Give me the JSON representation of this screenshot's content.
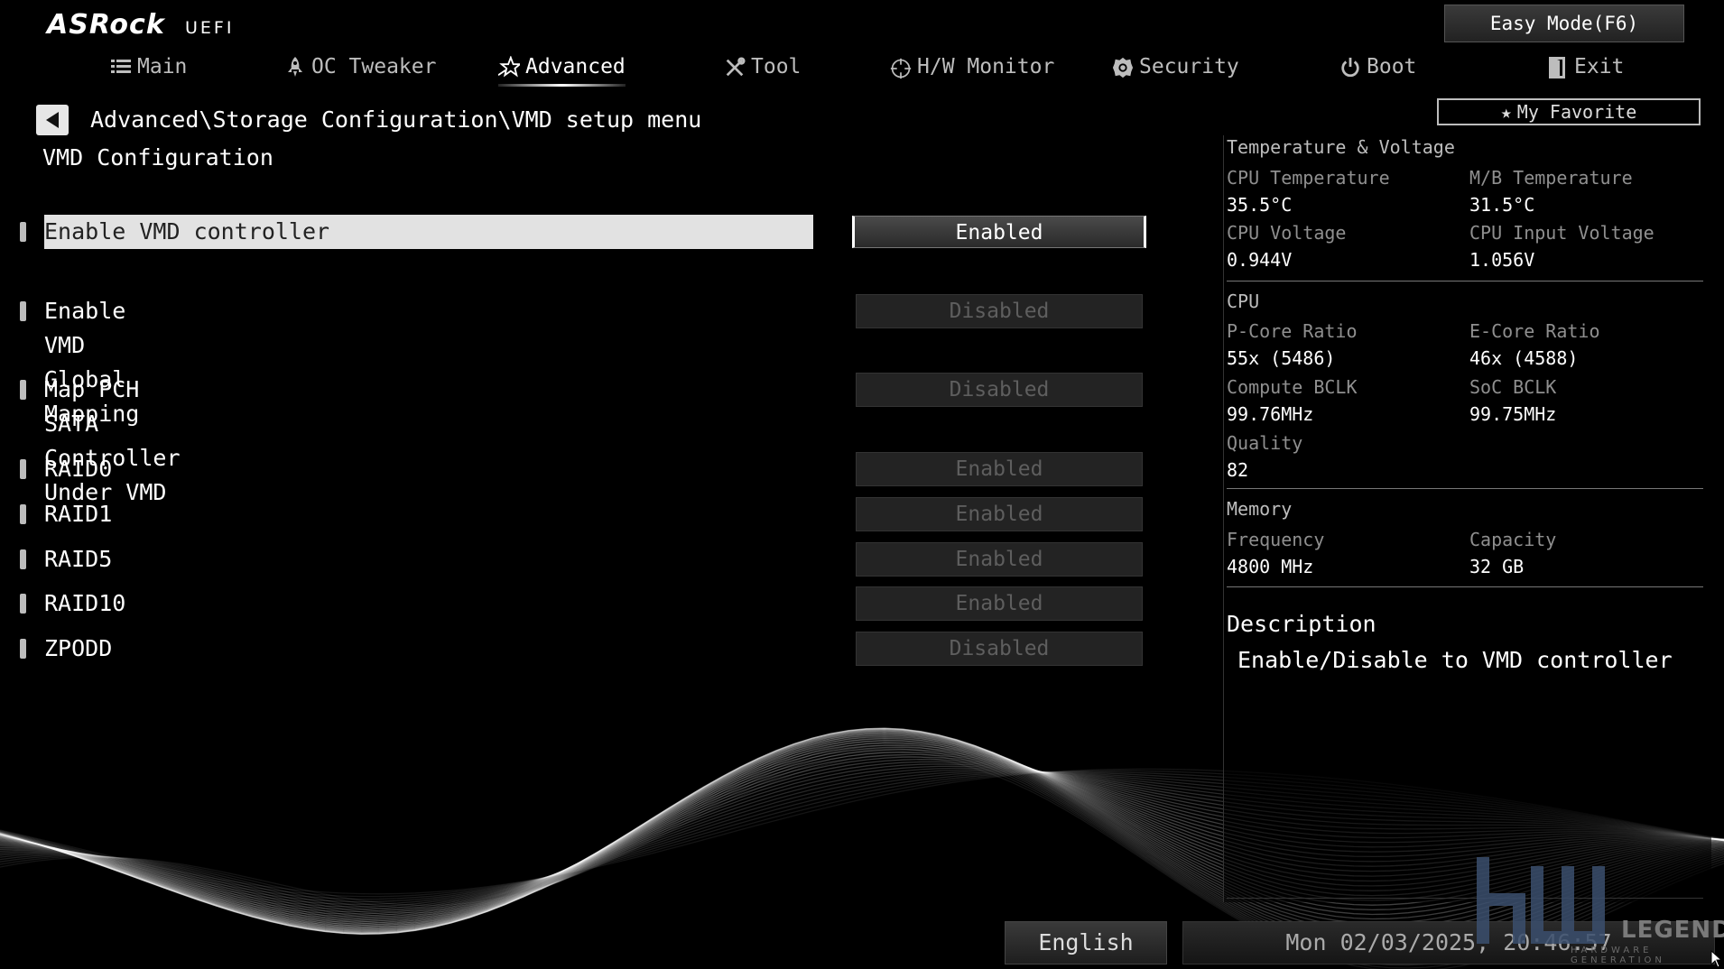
{
  "header": {
    "brand": "ASRock",
    "brand_sub": "UEFI",
    "easy_mode": "Easy Mode(F6)",
    "my_favorite": "My Favorite"
  },
  "tabs": [
    {
      "label": "Main",
      "icon": "list-icon"
    },
    {
      "label": "OC Tweaker",
      "icon": "rocket-icon"
    },
    {
      "label": "Advanced",
      "icon": "star-icon",
      "active": true
    },
    {
      "label": "Tool",
      "icon": "tools-icon"
    },
    {
      "label": "H/W Monitor",
      "icon": "crosshair-icon"
    },
    {
      "label": "Security",
      "icon": "shield-icon"
    },
    {
      "label": "Boot",
      "icon": "power-icon"
    },
    {
      "label": "Exit",
      "icon": "exit-icon"
    }
  ],
  "breadcrumb": "Advanced\\Storage Configuration\\VMD setup menu",
  "page_title": "VMD Configuration",
  "settings": [
    {
      "label": "Enable VMD controller",
      "value": "Enabled",
      "selected": true
    },
    {
      "label": "Enable VMD Global Mapping",
      "value": "Disabled"
    },
    {
      "label": "Map PCH SATA Controller Under VMD",
      "value": "Disabled"
    },
    {
      "label": "RAID0",
      "value": "Enabled"
    },
    {
      "label": "RAID1",
      "value": "Enabled"
    },
    {
      "label": "RAID5",
      "value": "Enabled"
    },
    {
      "label": "RAID10",
      "value": "Enabled"
    },
    {
      "label": "ZPODD",
      "value": "Disabled"
    }
  ],
  "panel": {
    "temp_voltage": {
      "title": "Temperature & Voltage",
      "cpu_temp_label": "CPU Temperature",
      "cpu_temp": "35.5°C",
      "mb_temp_label": "M/B Temperature",
      "mb_temp": "31.5°C",
      "cpu_volt_label": "CPU Voltage",
      "cpu_volt": "0.944V",
      "cpu_input_label": "CPU Input Voltage",
      "cpu_input": "1.056V"
    },
    "cpu": {
      "title": "CPU",
      "pcore_label": "P-Core Ratio",
      "pcore": "55x (5486)",
      "ecore_label": "E-Core Ratio",
      "ecore": "46x (4588)",
      "bclk_label": "Compute BCLK",
      "bclk": "99.76MHz",
      "soc_label": "SoC BCLK",
      "soc": "99.75MHz",
      "quality_label": "Quality",
      "quality": "82"
    },
    "memory": {
      "title": "Memory",
      "freq_label": "Frequency",
      "freq": "4800 MHz",
      "cap_label": "Capacity",
      "cap": "32 GB"
    },
    "description": {
      "title": "Description",
      "text": "Enable/Disable to VMD controller"
    }
  },
  "footer": {
    "language": "English",
    "datetime": "Mon 02/03/2025, 20:46:57"
  },
  "watermark": {
    "text": "LEGEND",
    "sub": "HARDWARE GENERATION"
  },
  "colors": {
    "background": "#000000",
    "text": "#ffffff",
    "selected_row": "#e2e2e2",
    "disabled_option": "#5e5e5e"
  }
}
